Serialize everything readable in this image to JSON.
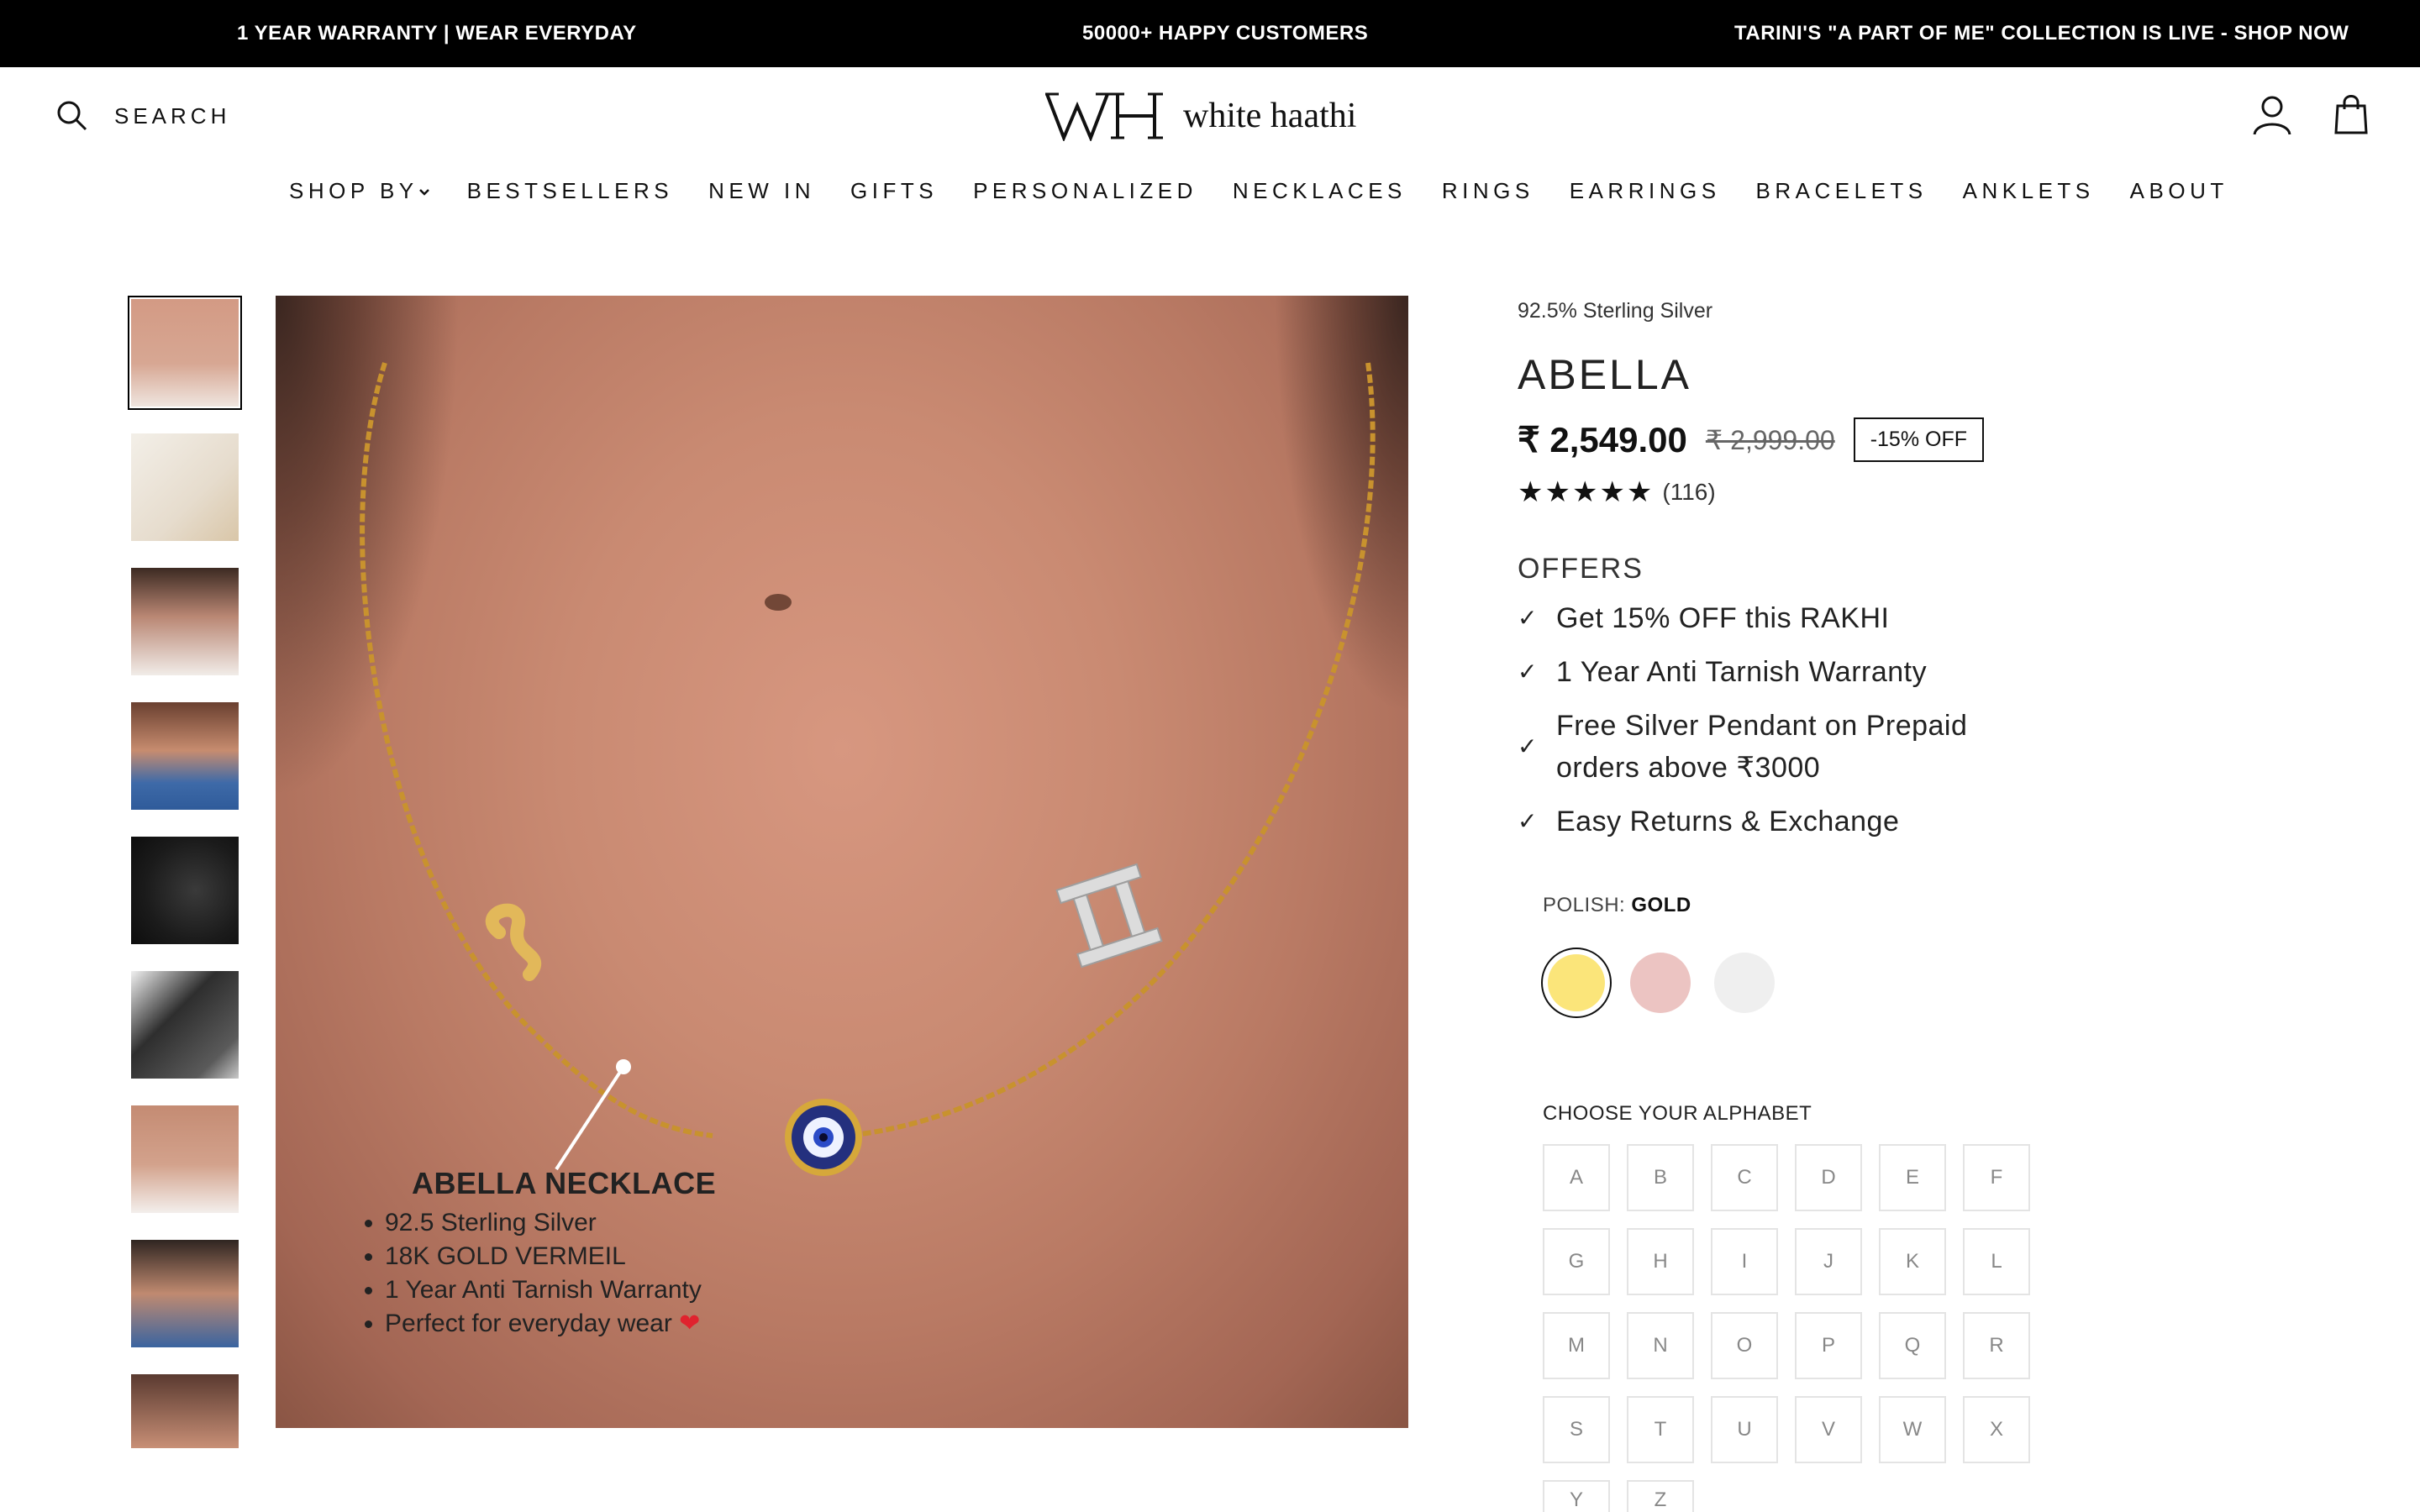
{
  "announcement": {
    "left": "1 YEAR WARRANTY | WEAR EVERYDAY",
    "center": "50000+ HAPPY CUSTOMERS",
    "right": "TARINI'S \"A PART OF ME\" COLLECTION IS LIVE - SHOP NOW"
  },
  "header": {
    "search_label": "SEARCH",
    "logo_text": "white haathi",
    "logo_mark": "WH",
    "icons": [
      "search-icon",
      "account-icon",
      "cart-icon"
    ]
  },
  "nav": {
    "items": [
      "SHOP BY",
      "BESTSELLERS",
      "NEW IN",
      "GIFTS",
      "PERSONALIZED",
      "NECKLACES",
      "RINGS",
      "EARRINGS",
      "BRACELETS",
      "ANKLETS",
      "ABOUT"
    ]
  },
  "gallery": {
    "thumbnail_count": 9,
    "active_index": 0,
    "overlay_title": "ABELLA NECKLACE",
    "overlay_points": [
      "92.5 Sterling Silver",
      "18K GOLD VERMEIL",
      "1 Year Anti Tarnish Warranty",
      "Perfect for everyday wear"
    ]
  },
  "product": {
    "material": "92.5% Sterling Silver",
    "title": "ABELLA",
    "price": "₹ 2,549.00",
    "compare_price": "₹ 2,999.00",
    "discount": "-15% OFF",
    "rating_stars": 5,
    "review_count": "(116)",
    "offers_title": "OFFERS",
    "offers": [
      "Get 15% OFF this RAKHI",
      "1 Year Anti Tarnish Warranty",
      "Free Silver Pendant on Prepaid orders above ₹3000",
      "Easy Returns & Exchange"
    ]
  },
  "polish": {
    "label": "POLISH:",
    "selected": "GOLD",
    "options": [
      {
        "name": "gold",
        "color": "#fbe57a"
      },
      {
        "name": "rose-gold",
        "color": "#ecc4c2"
      },
      {
        "name": "silver",
        "color": "#efefef"
      }
    ]
  },
  "alphabet": {
    "label": "CHOOSE YOUR ALPHABET",
    "letters": [
      "A",
      "B",
      "C",
      "D",
      "E",
      "F",
      "G",
      "H",
      "I",
      "J",
      "K",
      "L",
      "M",
      "N",
      "O",
      "P",
      "Q",
      "R",
      "S",
      "T",
      "U",
      "V",
      "W",
      "X",
      "Y",
      "Z"
    ]
  }
}
